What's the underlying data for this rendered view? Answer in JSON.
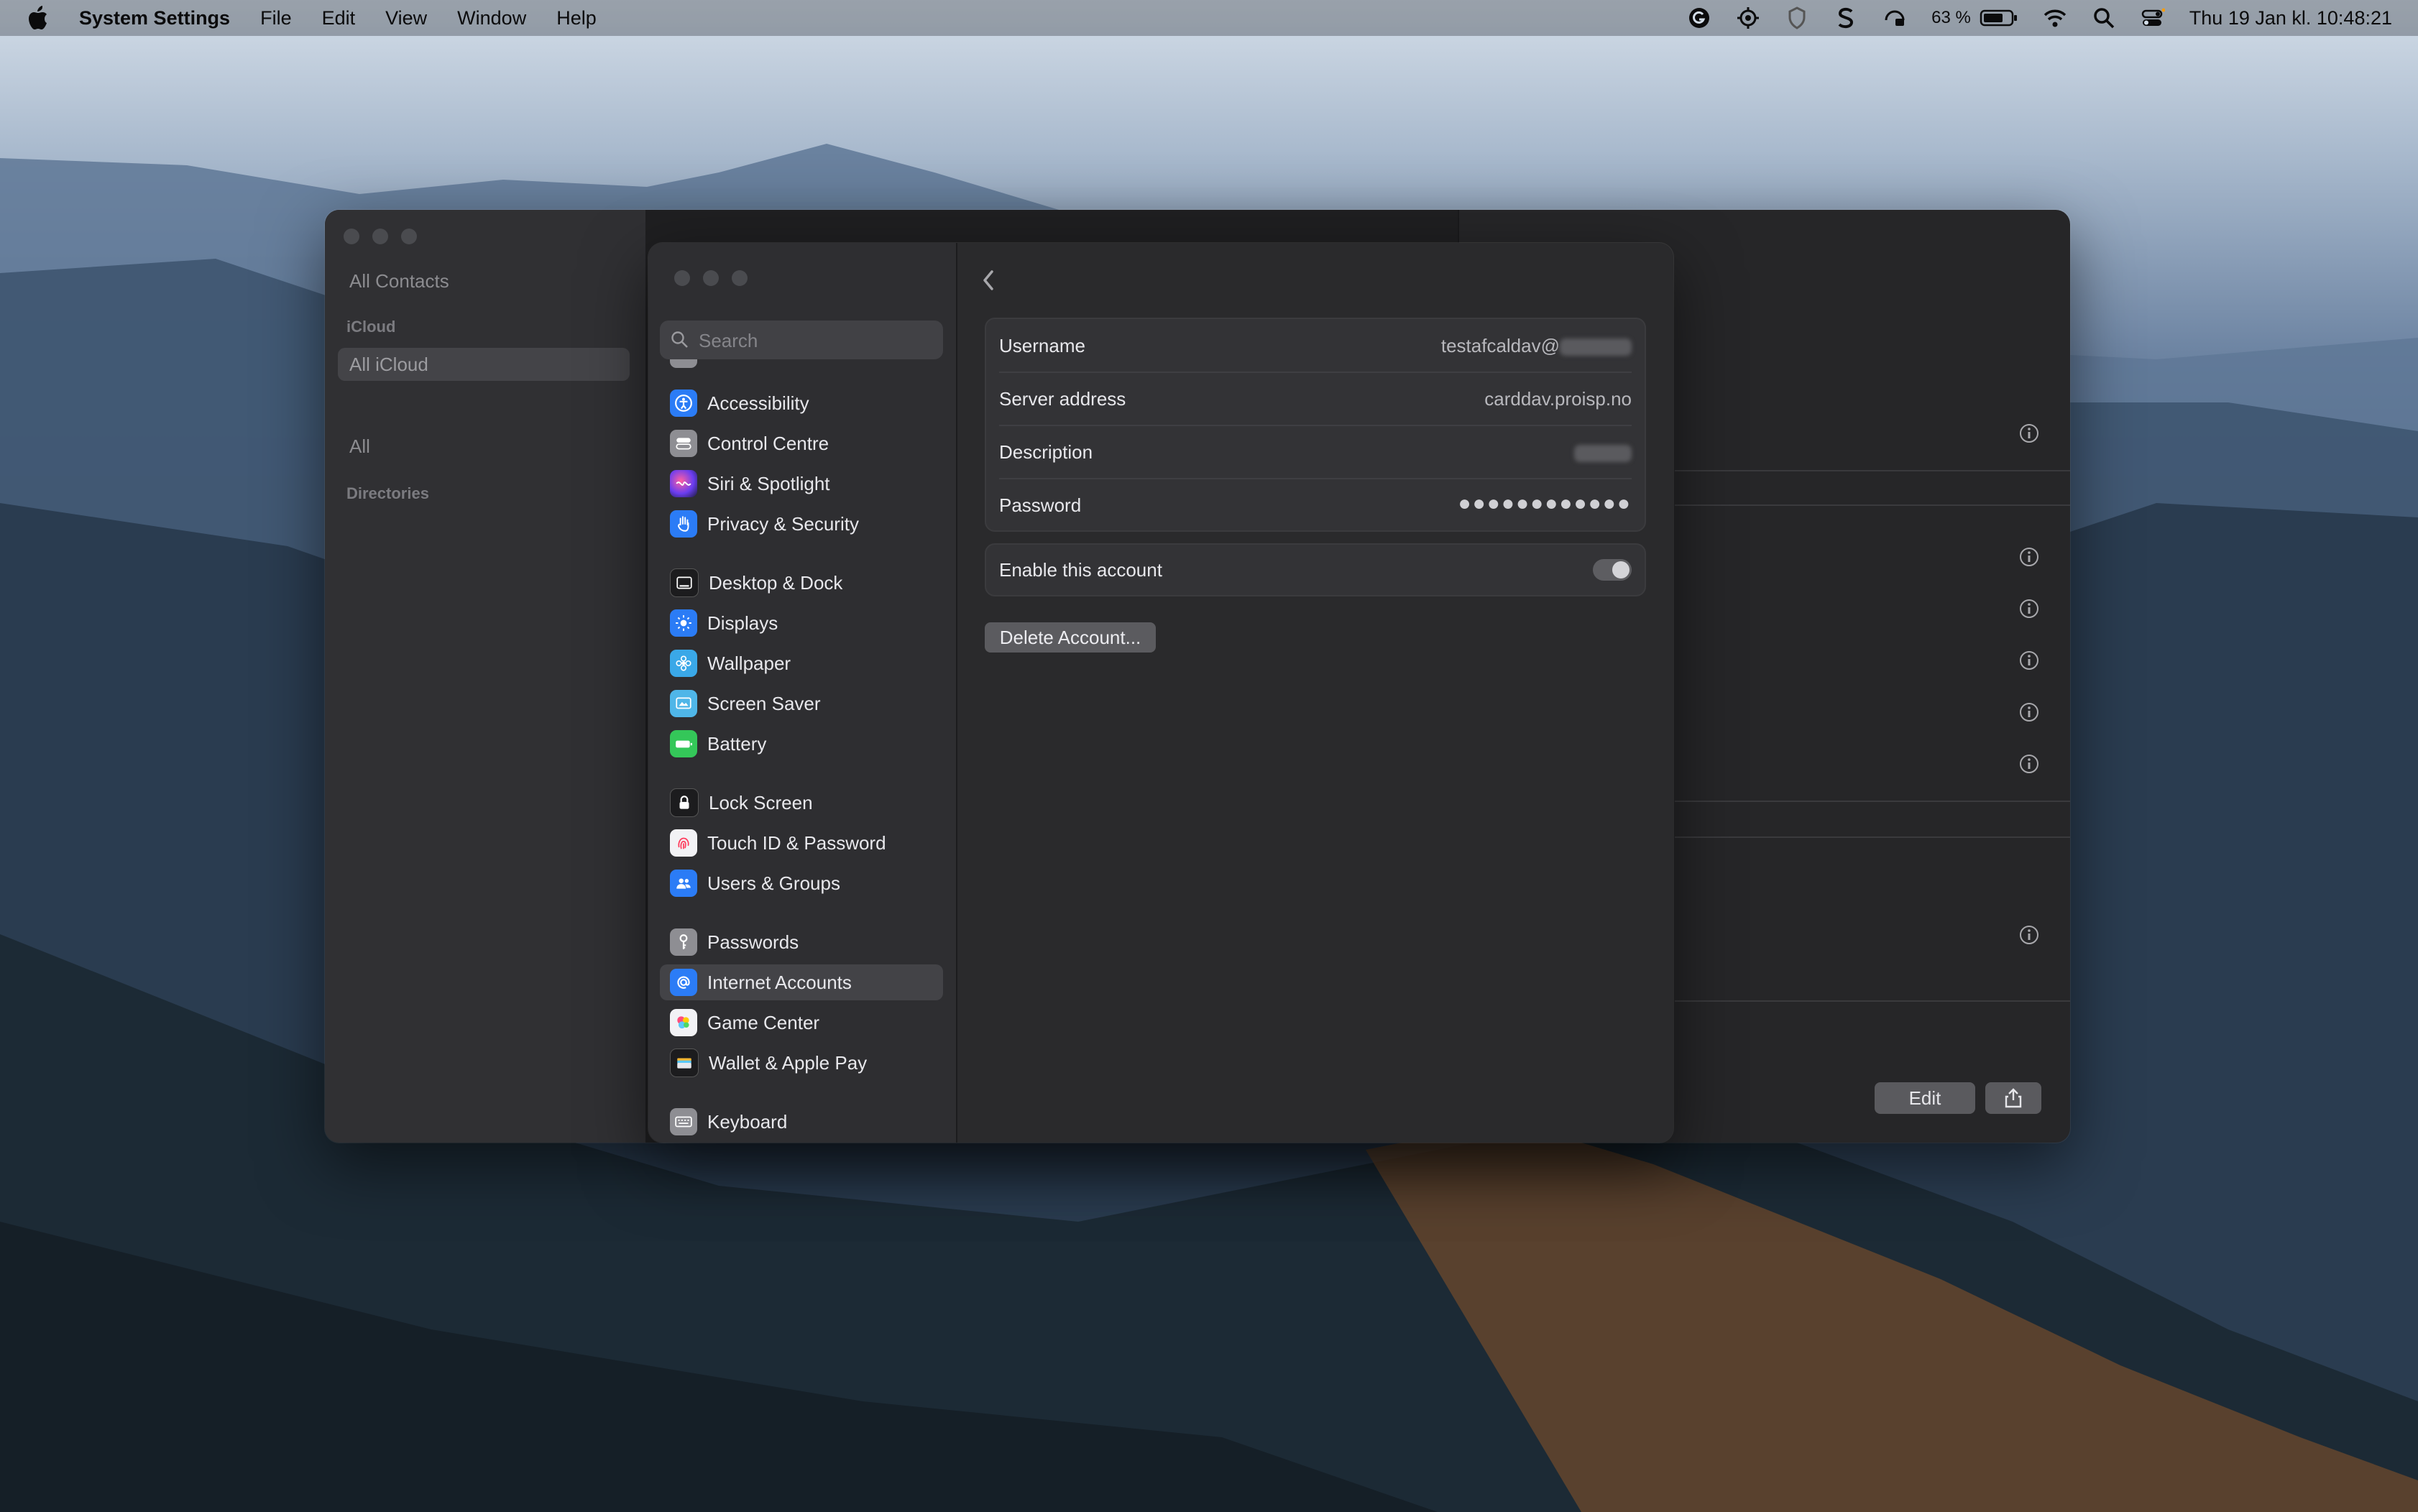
{
  "menubar": {
    "app_name": "System Settings",
    "menus": [
      "File",
      "Edit",
      "View",
      "Window",
      "Help"
    ],
    "battery_percent": "63 %",
    "clock": "Thu 19 Jan kl. 10:48:21"
  },
  "contacts": {
    "all_contacts": "All Contacts",
    "icloud_header": "iCloud",
    "all_icloud": "All iCloud",
    "all": "All",
    "directories": "Directories",
    "edit_label": "Edit"
  },
  "settings": {
    "search_placeholder": "Search",
    "sidebar_items": [
      {
        "label": "Accessibility",
        "icon": "accessibility-icon",
        "color": "#2b7cf6"
      },
      {
        "label": "Control Centre",
        "icon": "control-centre-icon",
        "color": "#8e8e93"
      },
      {
        "label": "Siri & Spotlight",
        "icon": "siri-icon",
        "color": "#9b4cd6"
      },
      {
        "label": "Privacy & Security",
        "icon": "hand-icon",
        "color": "#2b7cf6"
      },
      {
        "label": "Desktop & Dock",
        "icon": "desktop-dock-icon",
        "color": "#1c1c1e"
      },
      {
        "label": "Displays",
        "icon": "displays-icon",
        "color": "#2b7cf6"
      },
      {
        "label": "Wallpaper",
        "icon": "wallpaper-icon",
        "color": "#3aa8e8"
      },
      {
        "label": "Screen Saver",
        "icon": "screen-saver-icon",
        "color": "#4fb6e8"
      },
      {
        "label": "Battery",
        "icon": "battery-icon",
        "color": "#34c759"
      },
      {
        "label": "Lock Screen",
        "icon": "lock-icon",
        "color": "#1c1c1e"
      },
      {
        "label": "Touch ID & Password",
        "icon": "fingerprint-icon",
        "color": "#f2f2f5"
      },
      {
        "label": "Users & Groups",
        "icon": "users-icon",
        "color": "#2b7cf6"
      },
      {
        "label": "Passwords",
        "icon": "key-icon",
        "color": "#8e8e93"
      },
      {
        "label": "Internet Accounts",
        "icon": "at-icon",
        "color": "#2b7cf6"
      },
      {
        "label": "Game Center",
        "icon": "game-center-icon",
        "color": "#f2f2f5"
      },
      {
        "label": "Wallet & Apple Pay",
        "icon": "wallet-icon",
        "color": "#1c1c1e"
      },
      {
        "label": "Keyboard",
        "icon": "keyboard-icon",
        "color": "#8e8e93"
      }
    ],
    "selected_item": "Internet Accounts",
    "account": {
      "username_label": "Username",
      "username_value": "testafcaldav@",
      "server_label": "Server address",
      "server_value": "carddav.proisp.no",
      "description_label": "Description",
      "password_label": "Password",
      "password_value": "●●●●●●●●●●●●",
      "enable_label": "Enable this account",
      "delete_label": "Delete Account...",
      "help_label": "?"
    }
  }
}
